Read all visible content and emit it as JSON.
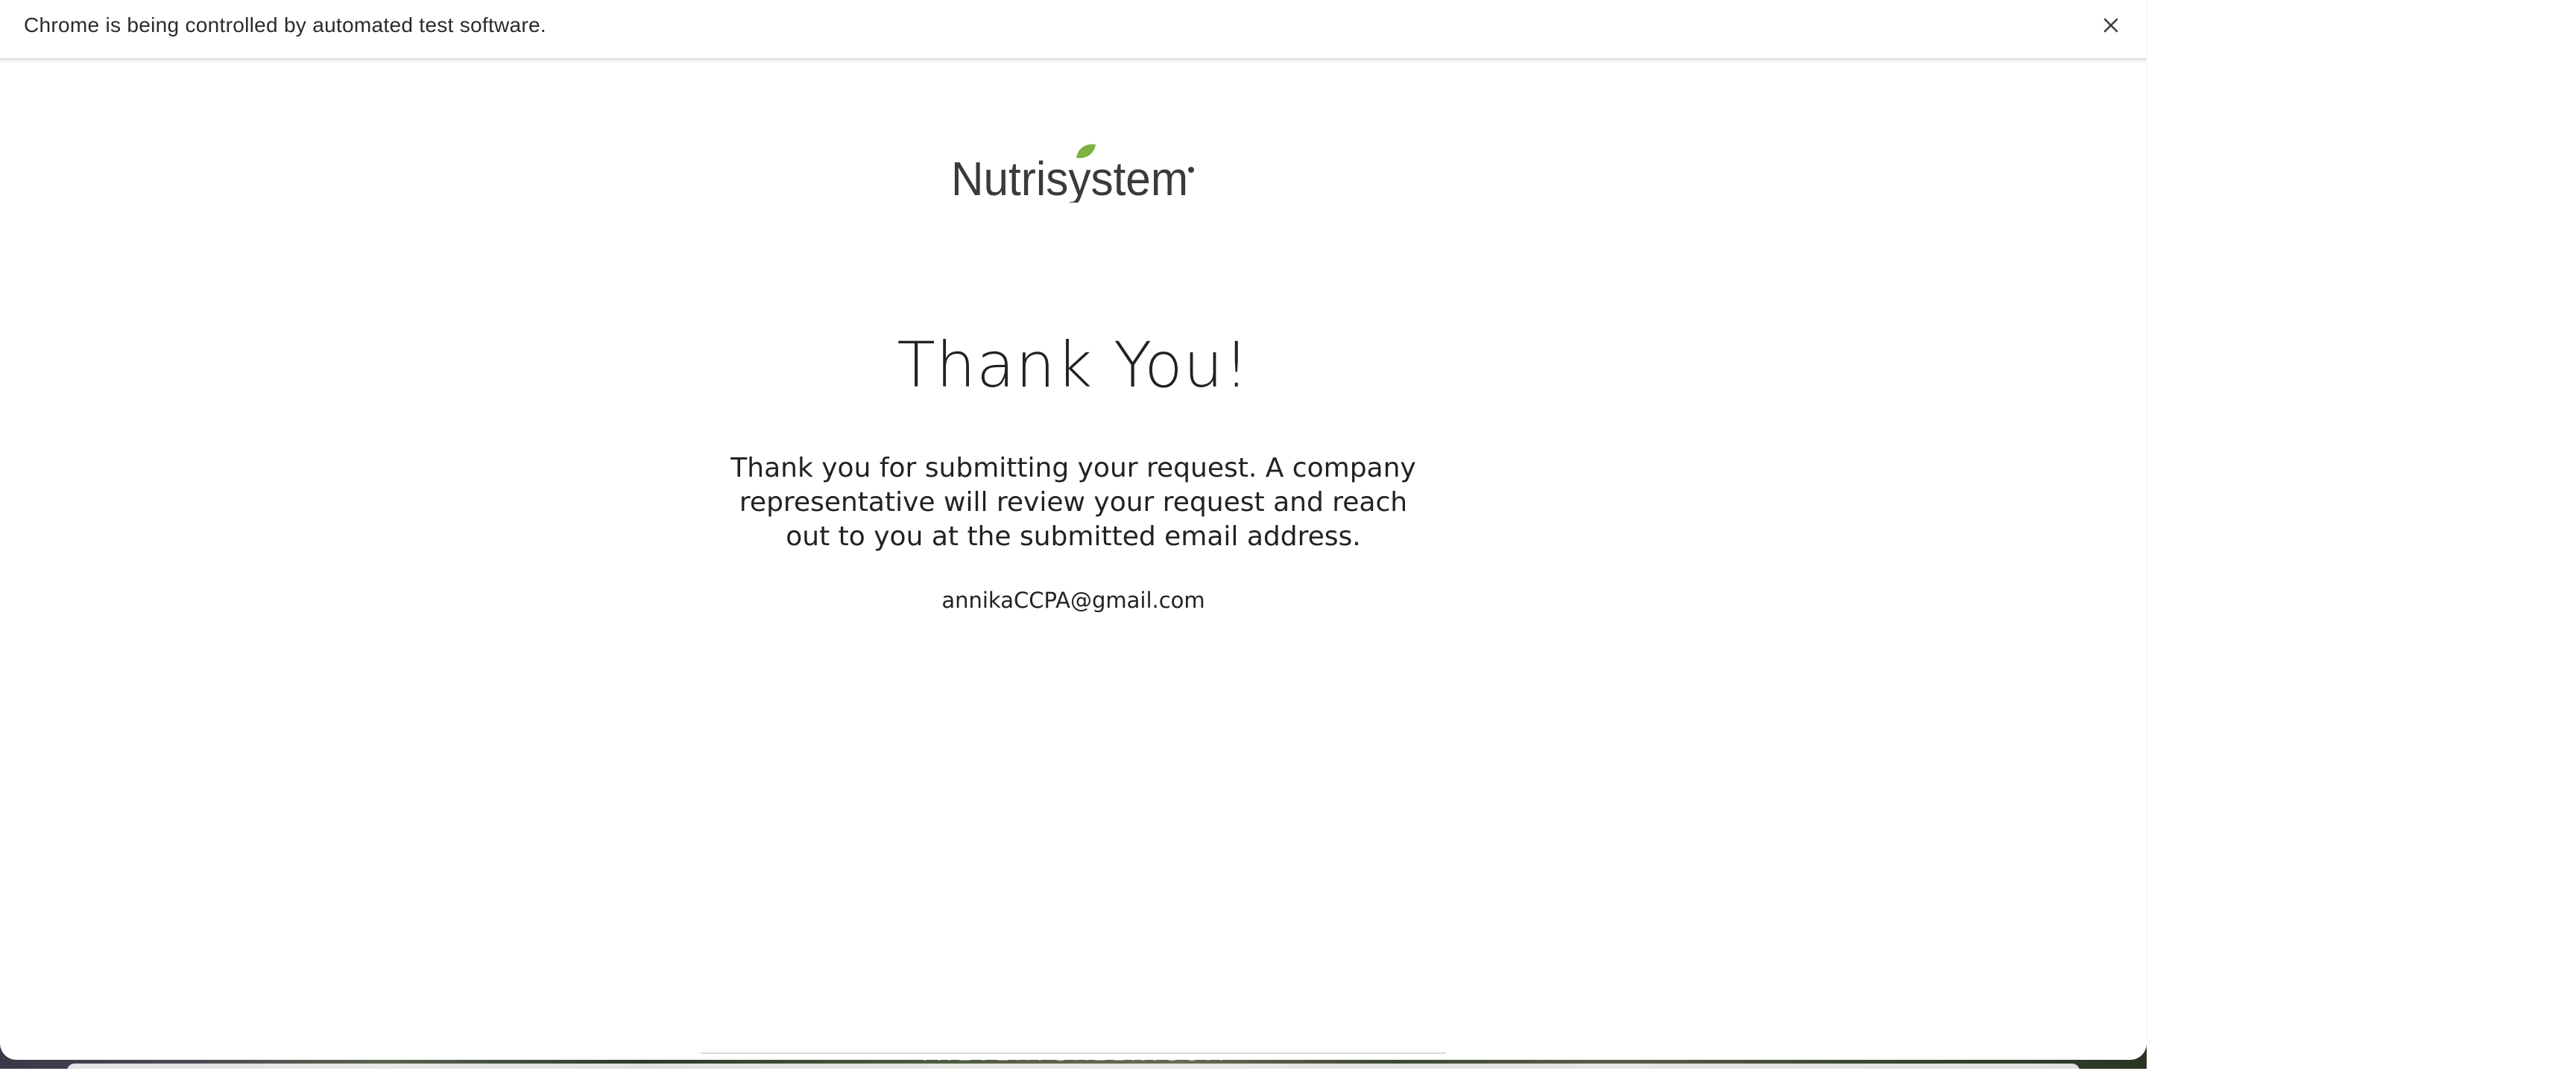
{
  "infobar": {
    "message": "Chrome is being controlled by automated test software.",
    "close_icon": "close-icon"
  },
  "brand": {
    "logo_text": "Nutrisystem",
    "logo_icon": "leaf-icon",
    "leaf_color": "#7cb342",
    "text_color": "#3a3a3a"
  },
  "content": {
    "title": "Thank You!",
    "message": "Thank you for submitting your request. A company representative will review your request and reach out to you at the submitted email address.",
    "email": "annikaCCPA@gmail.com"
  },
  "desktop": {
    "wallpaper_text": "THEVERYGREEN.COM"
  }
}
